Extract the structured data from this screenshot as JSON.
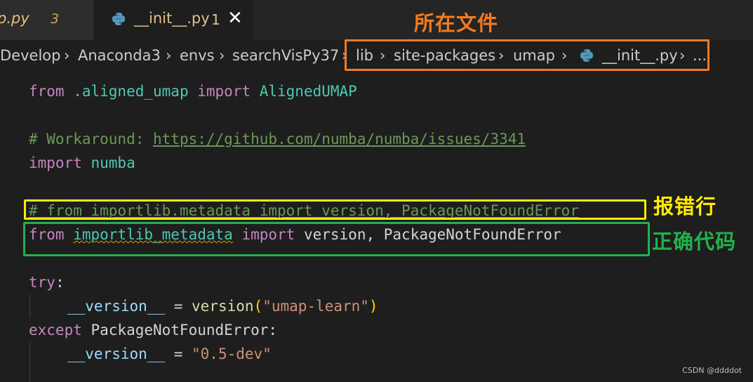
{
  "tabs": [
    {
      "name": "p.py",
      "badge": "3"
    },
    {
      "name": "__init__.py",
      "badge": "1",
      "close": "✕"
    }
  ],
  "breadcrumb": {
    "segments": [
      "Develop",
      "Anaconda3",
      "envs",
      "searchVisPy37",
      "lib",
      "site-packages",
      "umap",
      "__init__.py",
      "..."
    ],
    "separator": "›"
  },
  "code": {
    "l1": {
      "kw1": "from",
      "mod": " .aligned_umap ",
      "kw2": "import",
      "name": " AlignedUMAP"
    },
    "l3": {
      "prefix": "# Workaround: ",
      "url": "https://github.com/numba/numba/issues/3341"
    },
    "l4": {
      "kw": "import",
      "mod": " numba"
    },
    "l6": "# from importlib.metadata import version, PackageNotFoundError",
    "l7": {
      "kw1": "from",
      "mod": "importlib_metadata",
      "kw2": "import",
      "rest": " version, PackageNotFoundError"
    },
    "l9": {
      "kw": "try",
      "colon": ":"
    },
    "l10": {
      "var": "__version__",
      "eq": " = ",
      "fn": "version",
      "open": "(",
      "str": "\"umap-learn\"",
      "close": ")"
    },
    "l11": {
      "kw": "except",
      "rest": " PackageNotFoundError:"
    },
    "l12": {
      "var": "__version__",
      "eq": " = ",
      "str": "\"0.5-dev\""
    }
  },
  "annotations": {
    "file_label": "所在文件",
    "error_label": "报错行",
    "fix_label": "正确代码",
    "colors": {
      "file": "#f47a1f",
      "error": "#ffeb00",
      "fix": "#22b14c"
    }
  },
  "watermark": "CSDN @ddddot",
  "icons": [
    "python-icon",
    "close-icon",
    "chevron-right-icon"
  ]
}
